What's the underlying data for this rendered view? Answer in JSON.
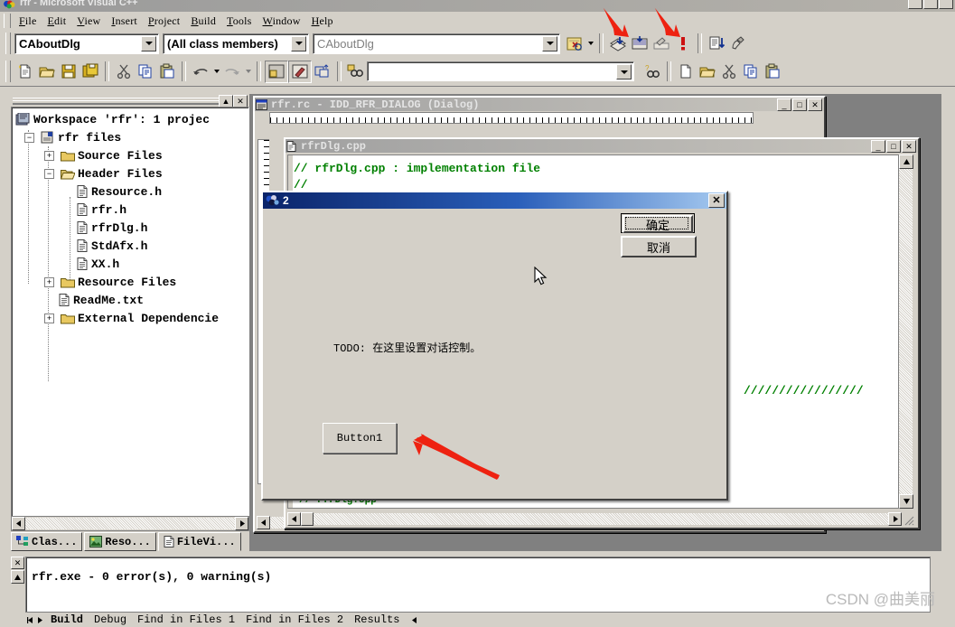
{
  "window": {
    "title": "rfr - Microsoft Visual C++",
    "icon": "vcpp-icon",
    "buttons": [
      "minimize",
      "maximize",
      "close"
    ]
  },
  "menu": {
    "items": [
      "File",
      "Edit",
      "View",
      "Insert",
      "Project",
      "Build",
      "Tools",
      "Window",
      "Help"
    ]
  },
  "toolbar_standard": {
    "class_combo": {
      "value": "CAboutDlg"
    },
    "members_combo": {
      "value": "(All class members)"
    },
    "function_combo": {
      "value": "CAboutDlg"
    },
    "icons": [
      "classview-lookup-icon",
      "build-compile-icon",
      "build-icon",
      "stop-build-icon",
      "execute-program-icon",
      "go-debug-icon",
      "insert-breakpoint-icon"
    ]
  },
  "toolbar_secondary": {
    "search_value": "",
    "icons": [
      "new-text-file-icon",
      "open-icon",
      "save-icon",
      "save-all-icon",
      "cut-icon",
      "copy-icon",
      "paste-icon",
      "undo-icon",
      "redo-icon",
      "workspace-toggle-icon",
      "output-toggle-icon",
      "window-list-icon",
      "find-in-files-icon",
      "find-icon",
      "new-icon",
      "open2-icon",
      "cut2-icon",
      "copy2-icon",
      "paste2-icon"
    ]
  },
  "workspace": {
    "caption_buttons": [
      "restore",
      "close"
    ],
    "tree": [
      {
        "label": "Workspace 'rfr': 1 projec",
        "indent": 0,
        "expander": "",
        "icon": "workspace-icon"
      },
      {
        "label": "rfr files",
        "indent": 1,
        "expander": "-",
        "icon": "project-icon"
      },
      {
        "label": "Source Files",
        "indent": 2,
        "expander": "+",
        "icon": "folder-icon"
      },
      {
        "label": "Header Files",
        "indent": 2,
        "expander": "-",
        "icon": "folder-open-icon"
      },
      {
        "label": "Resource.h",
        "indent": 3,
        "expander": "",
        "icon": "file-icon"
      },
      {
        "label": "rfr.h",
        "indent": 3,
        "expander": "",
        "icon": "file-icon"
      },
      {
        "label": "rfrDlg.h",
        "indent": 3,
        "expander": "",
        "icon": "file-icon"
      },
      {
        "label": "StdAfx.h",
        "indent": 3,
        "expander": "",
        "icon": "file-icon"
      },
      {
        "label": "XX.h",
        "indent": 3,
        "expander": "",
        "icon": "file-icon"
      },
      {
        "label": "Resource Files",
        "indent": 2,
        "expander": "+",
        "icon": "folder-icon"
      },
      {
        "label": "ReadMe.txt",
        "indent": 2,
        "expander": "",
        "icon": "file-icon"
      },
      {
        "label": "External Dependencie",
        "indent": 2,
        "expander": "+",
        "icon": "folder-icon"
      }
    ],
    "tabs": [
      {
        "label": "Clas...",
        "icon": "classview-icon",
        "active": false
      },
      {
        "label": "Reso...",
        "icon": "resourceview-icon",
        "active": false
      },
      {
        "label": "FileVi...",
        "icon": "fileview-icon",
        "active": true
      }
    ]
  },
  "resource_window": {
    "title": "rfr.rc - IDD_RFR_DIALOG  (Dialog)",
    "icon": "resource-doc-icon",
    "buttons": [
      "minimize",
      "maximize",
      "close"
    ]
  },
  "code_window": {
    "title": "rfrDlg.cpp",
    "icon": "cpp-doc-icon",
    "buttons": [
      "minimize",
      "maximize",
      "close"
    ],
    "lines": [
      "// rfrDlg.cpp : implementation file",
      "//"
    ],
    "comment_bar": "/////////////////"
  },
  "dialog": {
    "title": "2",
    "icon": "app-dialog-icon",
    "close_label": "✕",
    "ok_button": "确定",
    "cancel_button": "取消",
    "todo_text": "TODO: 在这里设置对话控制。",
    "button1": "Button1",
    "cursor": "mouse-pointer"
  },
  "output": {
    "close_label": "✕",
    "text": "rfr.exe - 0 error(s), 0 warning(s)",
    "tabs": [
      {
        "label": "Build",
        "active": true
      },
      {
        "label": "Debug",
        "active": false
      },
      {
        "label": "Find in Files 1",
        "active": false
      },
      {
        "label": "Find in Files 2",
        "active": false
      },
      {
        "label": "Results",
        "active": false
      }
    ]
  },
  "annotations": {
    "arrows": [
      "toolbar-build-arrow",
      "toolbar-execute-arrow",
      "button1-arrow"
    ],
    "color": "#ee2211"
  },
  "watermark": "CSDN @曲美丽",
  "colors": {
    "face": "#d4d0c8",
    "active_caption": "#0a246a",
    "comment_green": "#008000",
    "arrow_red": "#ee2211"
  }
}
